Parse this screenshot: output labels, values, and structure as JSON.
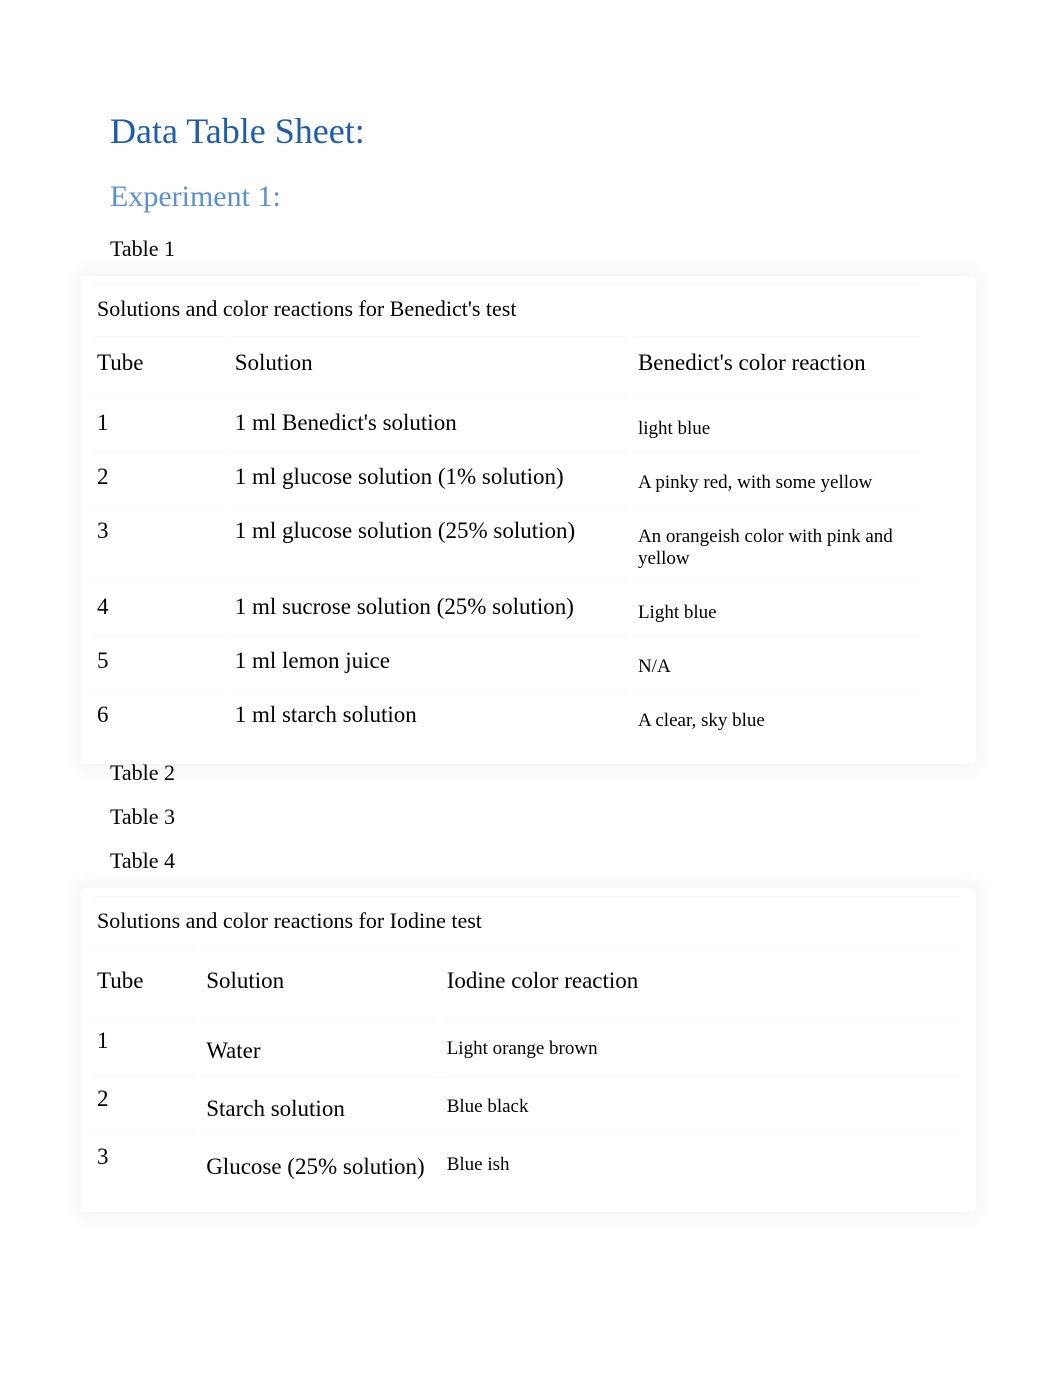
{
  "headings": {
    "main": "Data Table Sheet:",
    "experiment": "Experiment 1:"
  },
  "labels": {
    "table1": "Table 1",
    "table2": "Table 2",
    "table3": "Table 3",
    "table4": "Table 4"
  },
  "table1": {
    "caption": "Solutions and color reactions for Benedict's test",
    "headers": {
      "tube": "Tube",
      "solution": "Solution",
      "reaction": "Benedict's color reaction"
    },
    "rows": [
      {
        "tube": "1",
        "solution": "1 ml Benedict's solution",
        "reaction": "light blue"
      },
      {
        "tube": "2",
        "solution": "1 ml glucose solution (1% solution)",
        "reaction": "A pinky red, with some yellow"
      },
      {
        "tube": "3",
        "solution": "1 ml glucose solution (25% solution)",
        "reaction": "An orangeish color with pink and yellow"
      },
      {
        "tube": "4",
        "solution": "1 ml sucrose solution (25% solution)",
        "reaction": "Light blue"
      },
      {
        "tube": "5",
        "solution": "1 ml lemon juice",
        "reaction": "N/A"
      },
      {
        "tube": "6",
        "solution": "1 ml starch solution",
        "reaction": "A clear, sky blue"
      }
    ]
  },
  "table4": {
    "caption": "Solutions and color reactions for Iodine test",
    "headers": {
      "tube": "Tube",
      "solution": "Solution",
      "reaction": "Iodine color reaction"
    },
    "rows": [
      {
        "tube": "1",
        "solution": "Water",
        "reaction": "Light orange brown"
      },
      {
        "tube": "2",
        "solution": "Starch solution",
        "reaction": "Blue black"
      },
      {
        "tube": "3",
        "solution": "Glucose (25% solution)",
        "reaction": "Blue ish"
      }
    ]
  }
}
